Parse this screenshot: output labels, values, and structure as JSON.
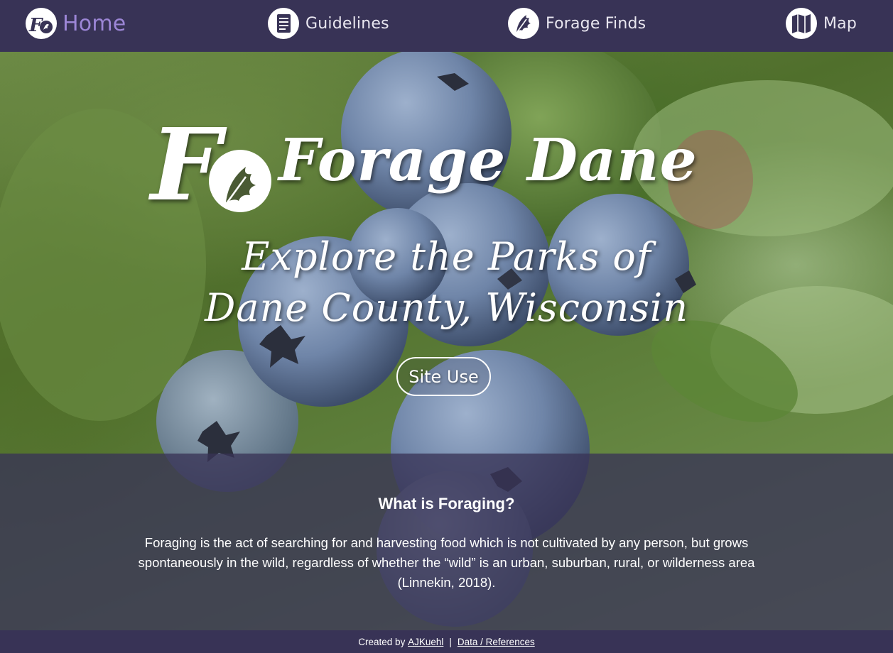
{
  "nav": {
    "home": {
      "label": "Home",
      "icon": "fd-logo-icon"
    },
    "guidelines": {
      "label": "Guidelines",
      "icon": "document-icon"
    },
    "forage_finds": {
      "label": "Forage Finds",
      "icon": "leaf-icon"
    },
    "map": {
      "label": "Map",
      "icon": "map-icon"
    }
  },
  "hero": {
    "logo_text": "Forage Dane",
    "tagline_line1": "Explore the Parks of",
    "tagline_line2": "Dane County, Wisconsin",
    "site_use_label": "Site Use"
  },
  "info": {
    "heading": "What is Foraging?",
    "body": "Foraging is the act of searching for and harvesting food which is not cultivated by any person, but grows spontaneously in the wild, regardless of whether the “wild” is an urban, suburban, rural, or wilderness area (Linnekin, 2018)."
  },
  "footer": {
    "created_by": "Created by",
    "author_link": "AJKuehl",
    "separator": "|",
    "references_link": "Data / References"
  },
  "colors": {
    "nav_bg": "#383356",
    "home_accent": "#9c86d6",
    "panel_bg": "rgba(56,51,86,0.78)",
    "text": "#ffffff"
  }
}
